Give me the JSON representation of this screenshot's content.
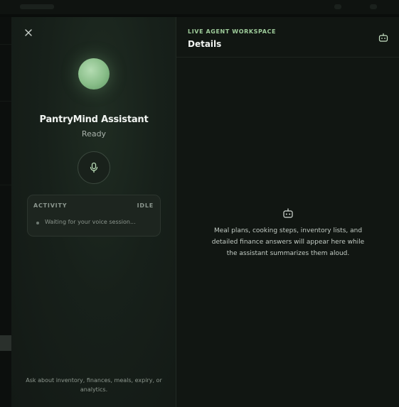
{
  "assistant": {
    "name": "PantryMind Assistant",
    "status": "Ready"
  },
  "activity": {
    "title": "ACTIVITY",
    "state": "IDLE",
    "message": "Waiting for your voice session..."
  },
  "hint": "Ask about inventory, finances, meals, expiry, or analytics.",
  "workspace": {
    "eyebrow": "LIVE AGENT WORKSPACE",
    "title": "Details",
    "empty_message": "Meal plans, cooking steps, inventory lists, and detailed finance answers will appear here while the assistant summarizes them aloud."
  },
  "icons": {
    "close": "close-icon",
    "mic": "microphone-icon",
    "header_bot": "bot-icon",
    "empty_bot": "bot-icon"
  },
  "colors": {
    "accent": "#9fcd9b",
    "orb": "#9fcb9c",
    "panel_left": "#17201a",
    "panel_right": "#111612"
  }
}
